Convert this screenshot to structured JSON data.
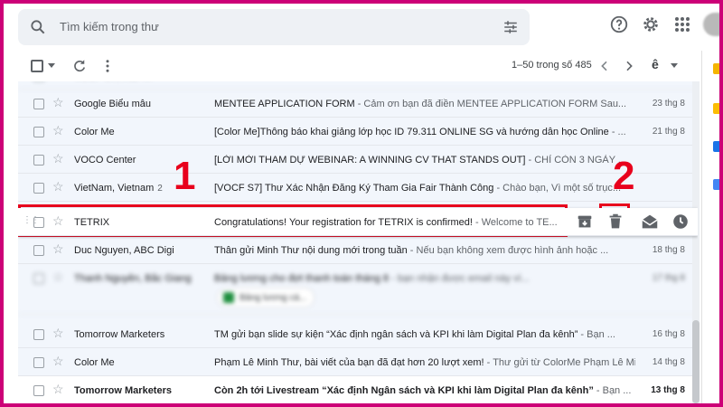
{
  "search": {
    "placeholder": "Tìm kiếm trong thư"
  },
  "header_icons": [
    "search-icon",
    "tune-icon",
    "help-icon",
    "gear-icon",
    "apps-grid-icon",
    "avatar"
  ],
  "toolbar": {
    "pagination": "1–50 trong số 485",
    "input_tool": "ê"
  },
  "emails": [
    {
      "sender": "Google Biểu mẫu",
      "subject": "MENTEE APPLICATION FORM",
      "snippet": " - Cảm ơn bạn đã điền MENTEE APPLICATION FORM Sau...",
      "date": "23 thg 8"
    },
    {
      "sender": "Color Me",
      "subject": "[Color Me]Thông báo khai giảng lớp học ID 79.311 ONLINE SG và hướng dẫn học Online",
      "snippet": " - ...",
      "date": "21 thg 8"
    },
    {
      "sender": "VOCO Center",
      "subject": "[LỜI MỜI THAM DỰ WEBINAR: A WINNING CV THAT STANDS OUT]",
      "snippet": " - CHỈ CÒN 3 NGÀY ...",
      "date": ""
    },
    {
      "sender": "VietNam, Vietnam",
      "count": "2",
      "subject": "[VOCF S7] Thư Xác Nhận Đăng Ký Tham Gia Fair Thành Công",
      "snippet": " - Chào bạn, Vì một số trục...",
      "date": ""
    },
    {
      "sender": "TETRIX",
      "subject": "Congratulations! Your registration for TETRIX is confirmed!",
      "snippet": " - Welcome to TE...",
      "date": ""
    },
    {
      "sender": "Duc Nguyen, ABC Digi",
      "subject": "Thân gửi Minh Thư nội dung mới trong tuần",
      "snippet": " - Nếu bạn không xem được hình ảnh hoặc ...",
      "date": "18 thg 8"
    },
    {
      "sender": "Thanh Nguyễn, Bắc Giang",
      "subject": "Bảng lương cho đợt thanh toán tháng 8",
      "snippet": " - bạn nhận được email này vì...",
      "date": "17 thg 8",
      "attachment": "Bảng lương cá..."
    },
    {
      "sender": "Tomorrow Marketers",
      "subject": "TM gửi bạn slide sự kiện “Xác định ngân sách và KPI khi làm Digital Plan đa kênh”",
      "snippet": " - Bạn ...",
      "date": "16 thg 8"
    },
    {
      "sender": "Color Me",
      "subject": "Phạm Lê Minh Thư, bài viết của bạn đã đạt hơn 20 lượt xem!",
      "snippet": " - Thư gửi từ ColorMe Phạm Lê Minh...",
      "date": "14 thg 8"
    },
    {
      "sender": "Tomorrow Marketers",
      "subject": "Còn 2h tới Livestream “Xác định Ngân sách và KPI khi làm Digital Plan đa kênh”",
      "snippet": " - Bạn ...",
      "date": "13 thg 8",
      "unread": true
    }
  ],
  "annotations": {
    "step1": "1",
    "step2": "2"
  },
  "colors": {
    "annotation": "#e8001c",
    "frame": "#cc0077",
    "list_bg": "#f2f6fc"
  }
}
